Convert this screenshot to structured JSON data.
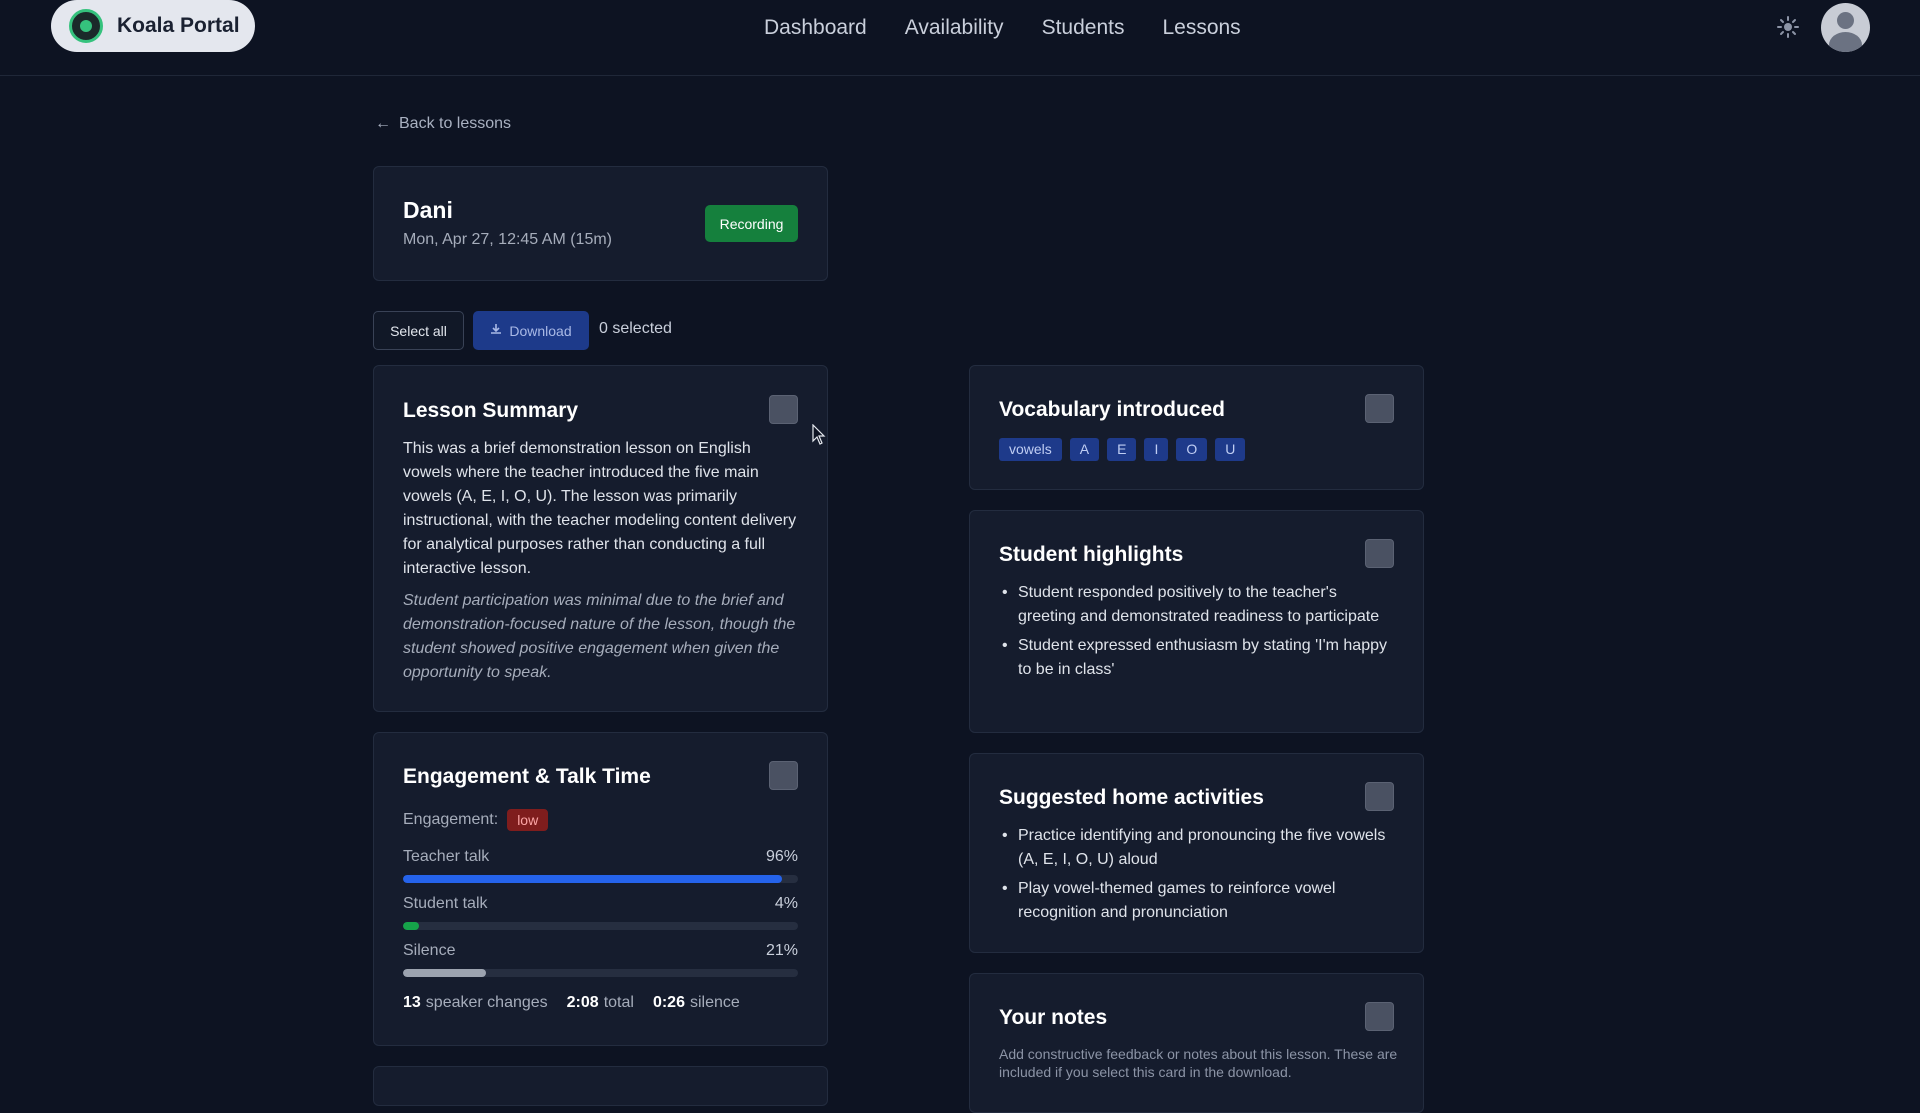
{
  "header": {
    "brand": "Koala Portal",
    "nav": [
      "Dashboard",
      "Availability",
      "Students",
      "Lessons"
    ],
    "icons": {
      "logo": "koala-logo-icon",
      "theme": "sun-icon",
      "avatar": "user-avatar-icon"
    }
  },
  "back_link": {
    "arrow": "←",
    "label": "Back to lessons"
  },
  "lesson": {
    "student": "Dani",
    "datetime": "Mon, Apr 27, 12:45 AM (15m)",
    "status": "Recording"
  },
  "toolbar": {
    "select_all": "Select all",
    "download": "Download",
    "selected": "0 selected"
  },
  "summary": {
    "title": "Lesson Summary",
    "body": "This was a brief demonstration lesson on English vowels where the teacher introduced the five main vowels (A, E, I, O, U). The lesson was primarily instructional, with the teacher modeling content delivery for analytical purposes rather than conducting a full interactive lesson.",
    "note": "Student participation was minimal due to the brief and demonstration-focused nature of the lesson, though the student showed positive engagement when given the opportunity to speak."
  },
  "engagement": {
    "title": "Engagement & Talk Time",
    "label": "Engagement:",
    "level": "low",
    "metrics": [
      {
        "label": "Teacher talk",
        "pct_text": "96%",
        "value": 96,
        "color": "#2563eb"
      },
      {
        "label": "Student talk",
        "pct_text": "4%",
        "value": 4,
        "color": "#16a34a"
      },
      {
        "label": "Silence",
        "pct_text": "21%",
        "value": 21,
        "color": "#9ca3af"
      }
    ],
    "stats": {
      "speaker_changes_value": "13",
      "speaker_changes_label": "speaker changes",
      "total_value": "2:08",
      "total_label": "total",
      "silence_value": "0:26",
      "silence_label": "silence"
    }
  },
  "vocabulary": {
    "title": "Vocabulary introduced",
    "chips": [
      "vowels",
      "A",
      "E",
      "I",
      "O",
      "U"
    ]
  },
  "highlights": {
    "title": "Student highlights",
    "items": [
      "Student responded positively to the teacher's greeting and demonstrated readiness to participate",
      "Student expressed enthusiasm by stating 'I'm happy to be in class'"
    ]
  },
  "activities": {
    "title": "Suggested home activities",
    "items": [
      "Practice identifying and pronouncing the five vowels (A, E, I, O, U) aloud",
      "Play vowel-themed games to reinforce vowel recognition and pronunciation"
    ]
  },
  "notes": {
    "title": "Your notes",
    "hint": "Add constructive feedback or notes about this lesson. These are included if you select this card in the download."
  },
  "colors": {
    "background": "#0d1322",
    "card": "#151c2d",
    "recording_badge": "#15803d",
    "download_button": "#1d3a8a",
    "engagement_low": "#7f1d1d"
  }
}
